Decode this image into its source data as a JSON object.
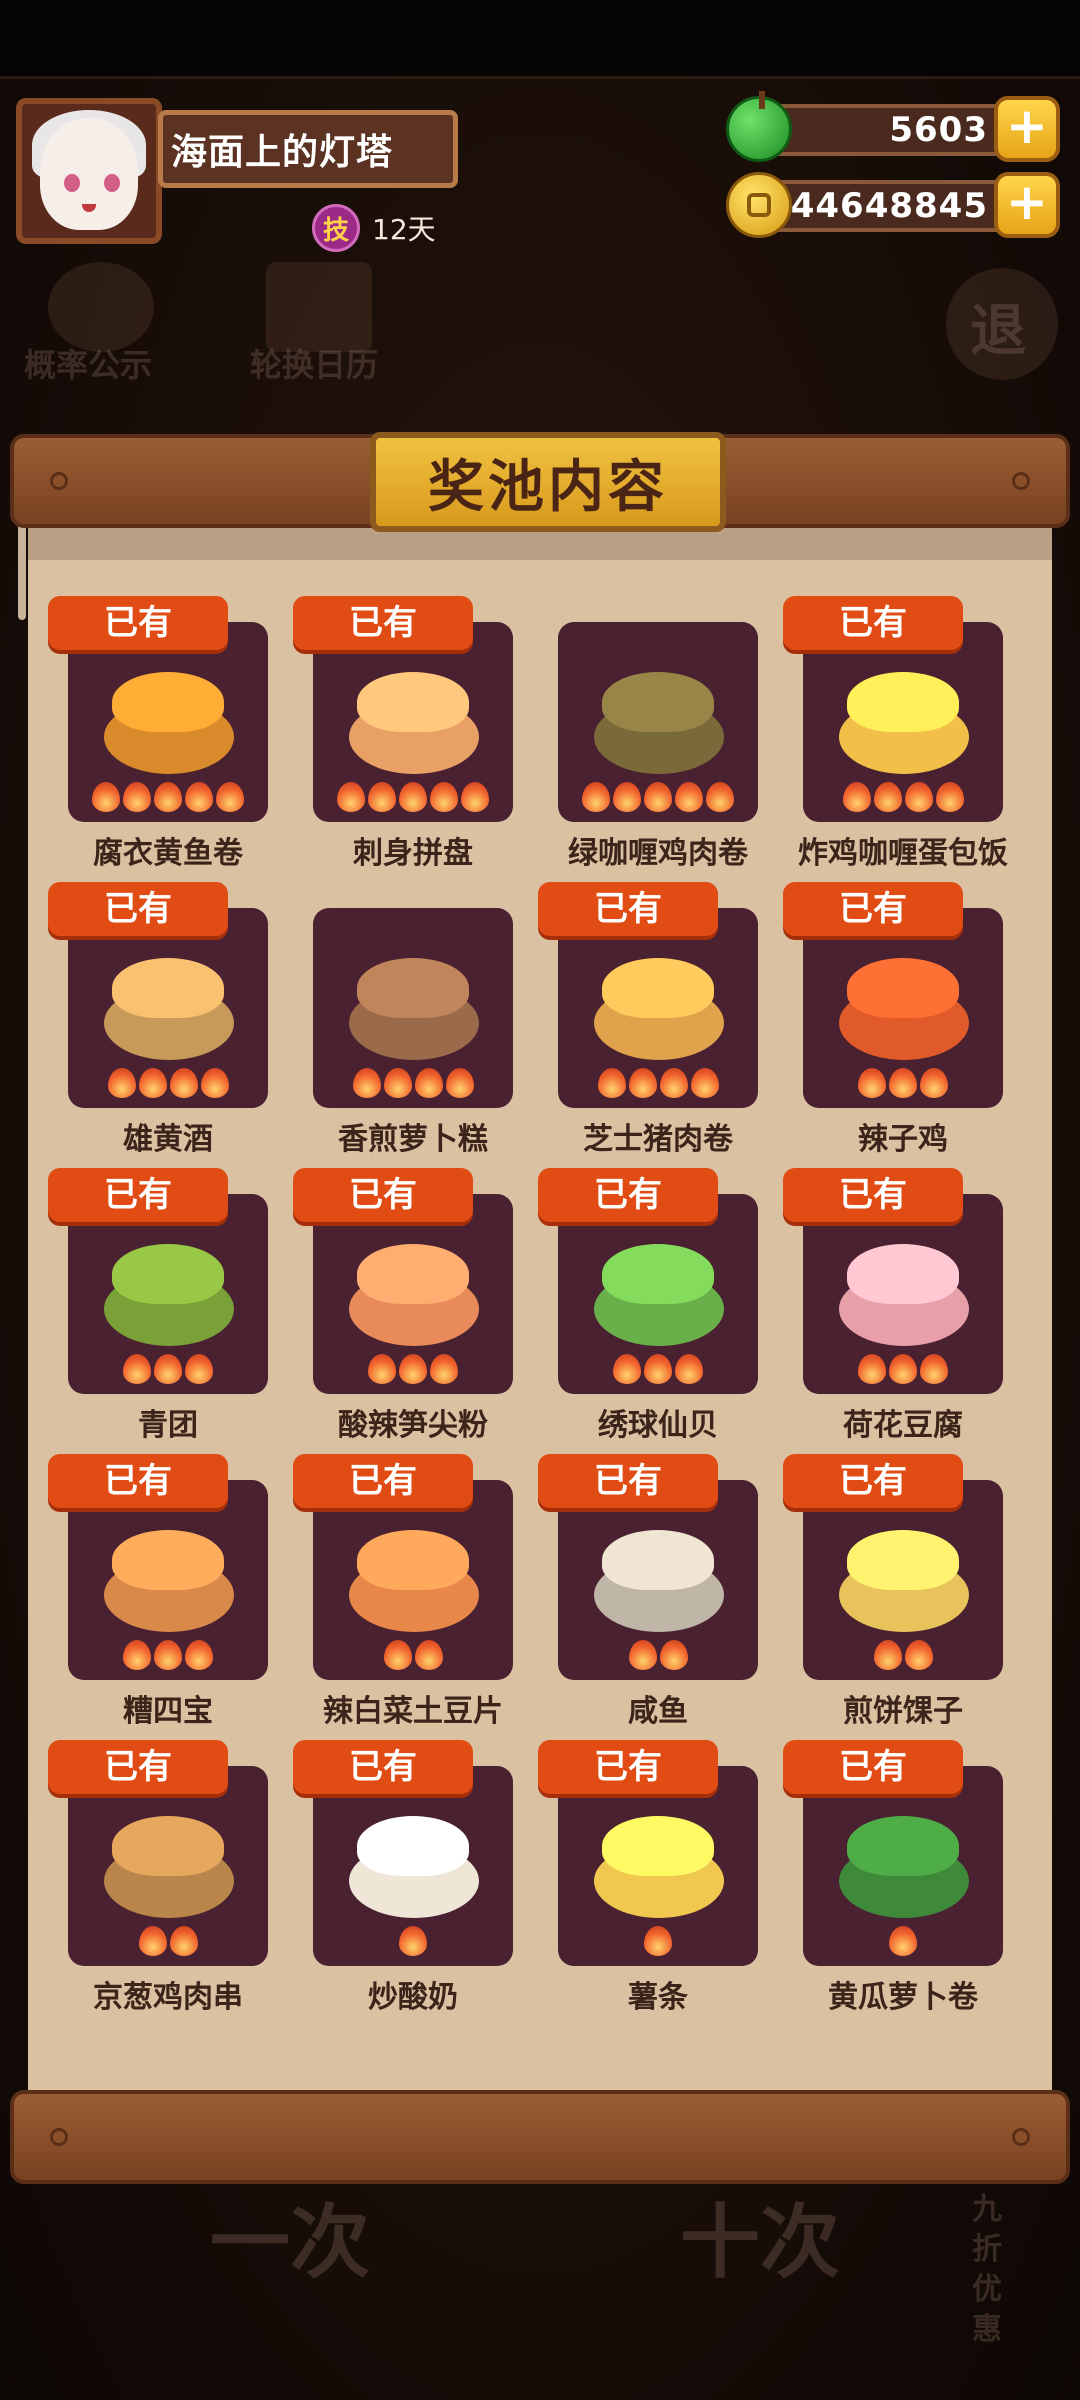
{
  "player": {
    "name": "海面上的灯塔",
    "skill_badge": "技",
    "skill_days": "12天",
    "avatar_icon": "player-avatar"
  },
  "currency": {
    "apples": "5603",
    "coins": "44648845",
    "apple_icon": "green-apple-icon",
    "coin_icon": "gold-coin-icon",
    "add_label": "+"
  },
  "background": {
    "probability": "概率公示",
    "calendar": "轮换日历",
    "exit": "退",
    "single": "一次",
    "ten": "十次",
    "discount": "九折优惠"
  },
  "modal": {
    "title": "奖池内容",
    "owned_label": "已有"
  },
  "items": [
    {
      "name": "腐衣黄鱼卷",
      "owned": true,
      "stars": 5,
      "color": "#d98a2a"
    },
    {
      "name": "刺身拼盘",
      "owned": true,
      "stars": 5,
      "color": "#e8a064"
    },
    {
      "name": "绿咖喱鸡肉卷",
      "owned": false,
      "stars": 5,
      "color": "#7a6a3a"
    },
    {
      "name": "炸鸡咖喱蛋包饭",
      "owned": true,
      "stars": 4,
      "color": "#f2c048"
    },
    {
      "name": "雄黄酒",
      "owned": true,
      "stars": 4,
      "color": "#c89a5a"
    },
    {
      "name": "香煎萝卜糕",
      "owned": false,
      "stars": 4,
      "color": "#9a6a4a"
    },
    {
      "name": "芝士猪肉卷",
      "owned": true,
      "stars": 4,
      "color": "#e0a24a"
    },
    {
      "name": "辣子鸡",
      "owned": true,
      "stars": 3,
      "color": "#e05a2a"
    },
    {
      "name": "青团",
      "owned": true,
      "stars": 3,
      "color": "#7aa038"
    },
    {
      "name": "酸辣笋尖粉",
      "owned": true,
      "stars": 3,
      "color": "#e88a5a"
    },
    {
      "name": "绣球仙贝",
      "owned": true,
      "stars": 3,
      "color": "#6ab04a"
    },
    {
      "name": "荷花豆腐",
      "owned": true,
      "stars": 3,
      "color": "#e8a0a8"
    },
    {
      "name": "糟四宝",
      "owned": true,
      "stars": 3,
      "color": "#d98a4a"
    },
    {
      "name": "辣白菜土豆片",
      "owned": true,
      "stars": 2,
      "color": "#e8874a"
    },
    {
      "name": "咸鱼",
      "owned": true,
      "stars": 2,
      "color": "#c0b6a8"
    },
    {
      "name": "煎饼馃子",
      "owned": true,
      "stars": 2,
      "color": "#e8c25a"
    },
    {
      "name": "京葱鸡肉串",
      "owned": true,
      "stars": 2,
      "color": "#b8864a"
    },
    {
      "name": "炒酸奶",
      "owned": true,
      "stars": 1,
      "color": "#efe6d8"
    },
    {
      "name": "薯条",
      "owned": true,
      "stars": 1,
      "color": "#f0c850"
    },
    {
      "name": "黄瓜萝卜卷",
      "owned": true,
      "stars": 1,
      "color": "#3f8a3a"
    }
  ]
}
